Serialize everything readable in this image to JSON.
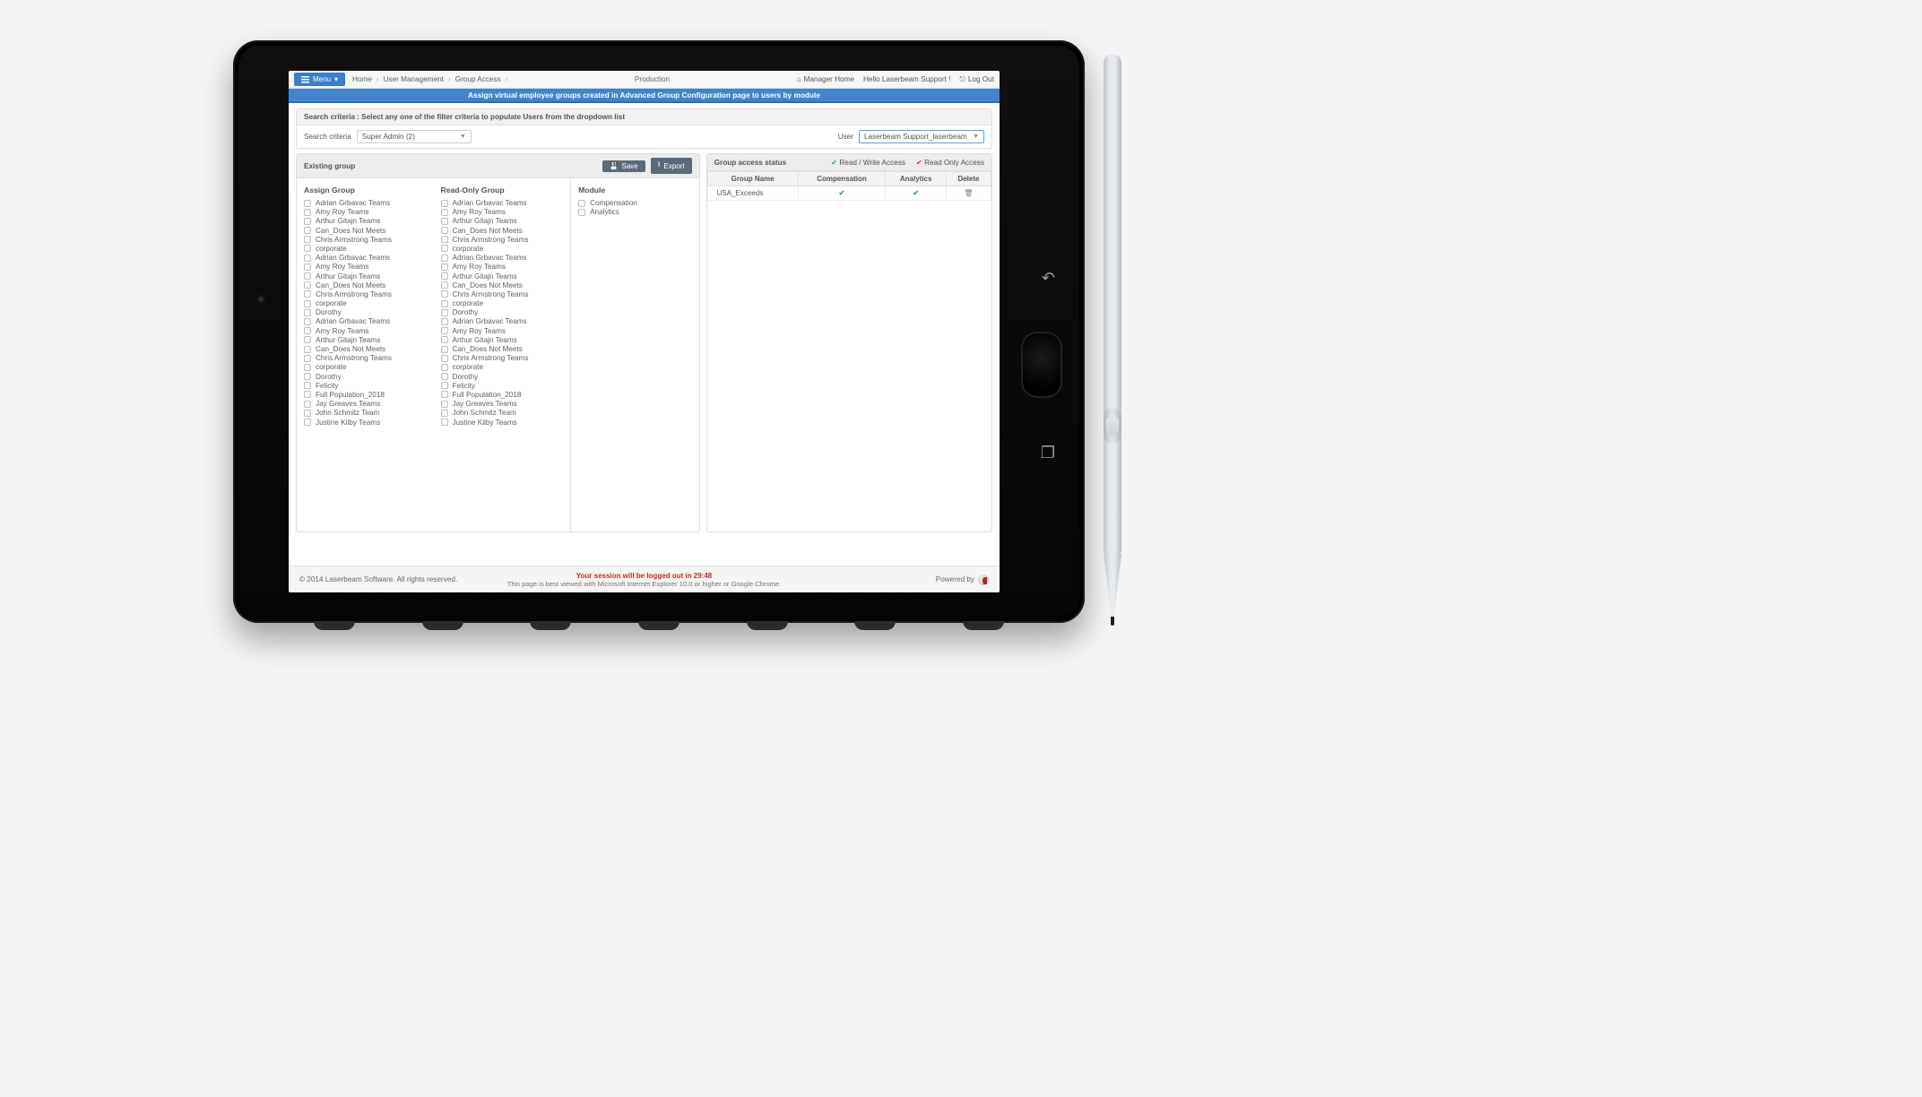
{
  "topbar": {
    "menu_label": "Menu",
    "breadcrumbs": [
      "Home",
      "User Management",
      "Group Access"
    ],
    "environment": "Production",
    "manager_home": "Manager Home",
    "greeting": "Hello Laserbeam Support !",
    "logout": "Log Out"
  },
  "banner": "Assign virtual employee groups created in Advanced Group Configuration page to users by module",
  "search": {
    "header": "Search criteria : Select any one of the filter criteria to populate Users from the dropdown list",
    "criteria_label": "Search criteria",
    "criteria_value": "Super Admin (2)",
    "user_label": "User",
    "user_value": "Laserbeam Support_laserbeam"
  },
  "leftPanel": {
    "header": "Existing group",
    "save": "Save",
    "export": "Export",
    "assign_title": "Assign Group",
    "readonly_title": "Read-Only Group",
    "module_title": "Module",
    "group_items": [
      "Adrian Grbavac Teams",
      "Amy Roy Teams",
      "Arthur Gitajn Teams",
      "Can_Does Not Meets",
      "Chris Armstrong Teams",
      "corporate",
      "Adrian Grbavac Teams",
      "Amy Roy Teams",
      "Arthur Gitajn Teams",
      "Can_Does Not Meets",
      "Chris Armstrong Teams",
      "corporate",
      "Dorothy",
      "Adrian Grbavac Teams",
      "Amy Roy Teams",
      "Arthur Gitajn Teams",
      "Can_Does Not Meets",
      "Chris Armstrong Teams",
      "corporate",
      "Dorothy",
      "Felicity",
      "Full Population_2018",
      "Jay Greaves Teams",
      "John Schmitz Team",
      "Justine Kilby Teams"
    ],
    "module_items": [
      "Compensation",
      "Analytics"
    ]
  },
  "rightPanel": {
    "header": "Group access status",
    "legend_rw": "Read / Write Access",
    "legend_ro": "Read Only Access",
    "cols": [
      "Group Name",
      "Compensation",
      "Analytics",
      "Delete"
    ],
    "rows": [
      {
        "name": "USA_Exceeds",
        "compensation": true,
        "analytics": true
      }
    ]
  },
  "footer": {
    "copyright": "© 2014 Laserbeam Software. All rights reserved.",
    "session_warn": "Your session will be logged out in 29:48",
    "browser_note": "This page is best viewed with Microsoft Internet Explorer 10.0 or higher or Google Chrome.",
    "powered_by": "Powered by"
  }
}
